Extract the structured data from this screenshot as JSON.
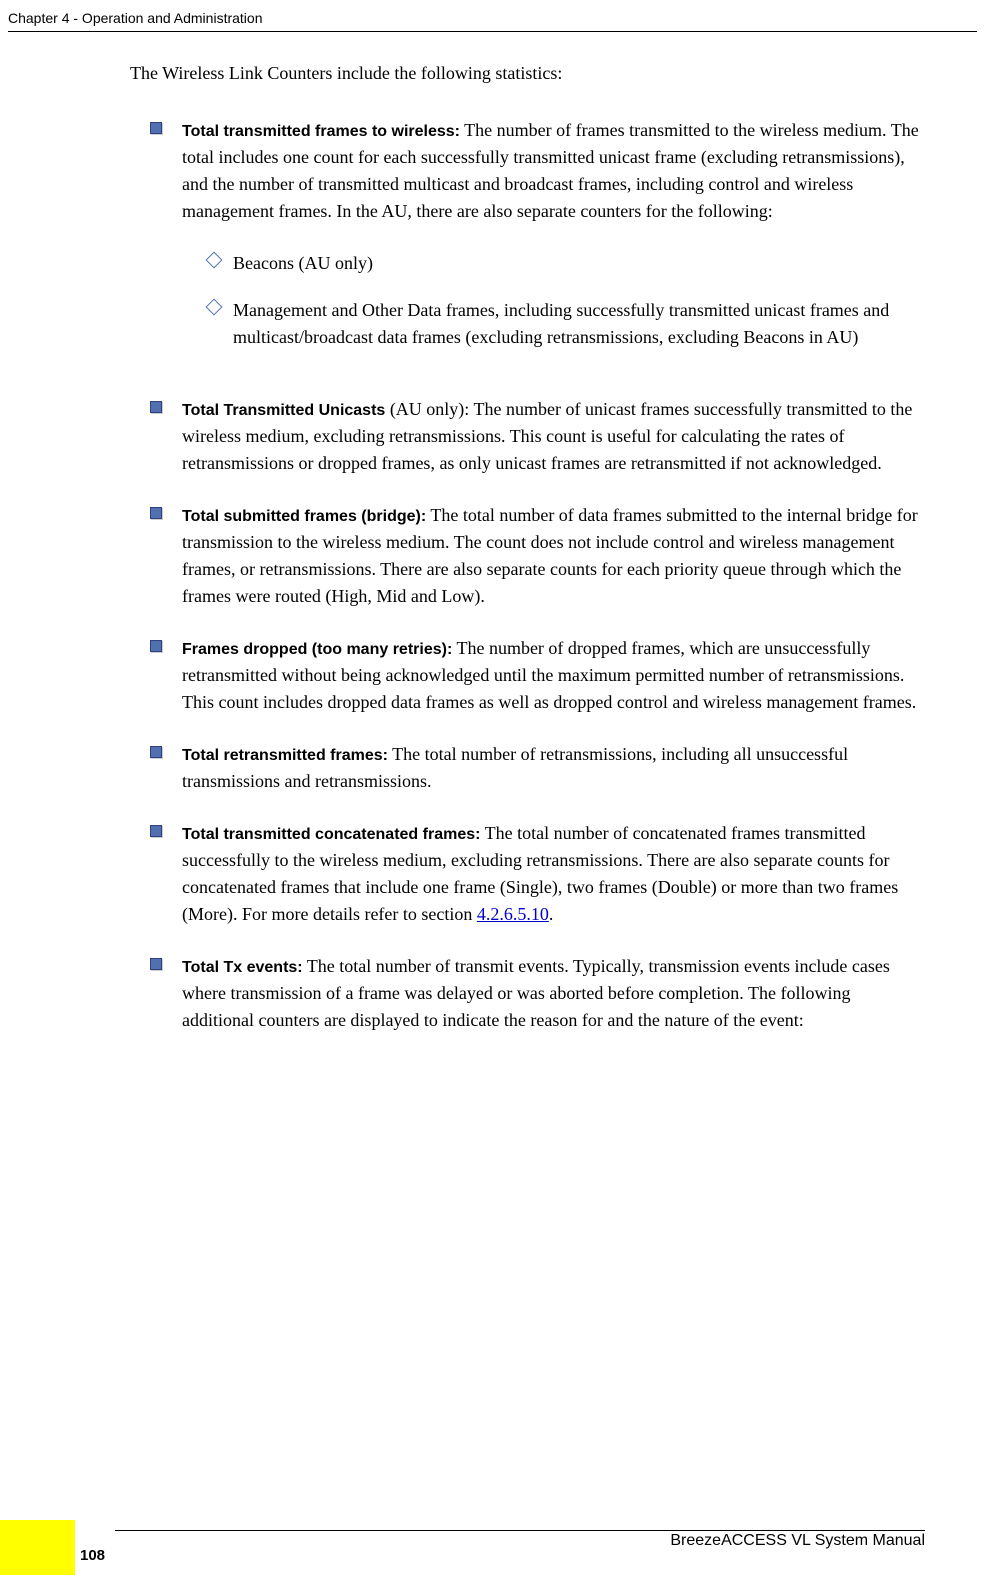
{
  "header": "Chapter 4 - Operation and Administration",
  "intro": "The Wireless Link Counters include the following statistics:",
  "items": [
    {
      "title": "Total transmitted frames to wireless:",
      "body": " The number of frames transmitted to the wireless medium. The total includes one count for each successfully transmitted unicast frame (excluding retransmissions), and the number of transmitted multicast and broadcast frames, including control and wireless management frames. In the AU, there are also separate counters for the following:",
      "sub": [
        "Beacons (AU only)",
        "Management and Other Data frames, including successfully transmitted unicast frames and multicast/broadcast data frames (excluding retransmissions, excluding Beacons in AU)"
      ]
    },
    {
      "title": "Total Transmitted Unicasts",
      "body": " (AU only): The number of unicast frames successfully transmitted to the wireless medium, excluding retransmissions. This count is useful for calculating the rates of retransmissions or dropped frames, as only unicast frames are retransmitted if not acknowledged."
    },
    {
      "title": "Total submitted frames (bridge):",
      "body": " The total number of data frames submitted to the internal bridge for transmission to the wireless medium. The count does not include control and wireless management frames, or retransmissions. There are also separate counts for each priority queue through which the frames were routed (High, Mid and Low)."
    },
    {
      "title": "Frames dropped (too many retries):",
      "body": " The number of dropped frames, which are unsuccessfully retransmitted without being acknowledged until the maximum permitted number of retransmissions. This count includes dropped data frames as well as dropped control and wireless management frames."
    },
    {
      "title": "Total retransmitted frames:",
      "body": " The total number of retransmissions, including all unsuccessful transmissions and retransmissions."
    },
    {
      "title": "Total transmitted concatenated frames:",
      "body": " The total number of concatenated frames transmitted successfully to the wireless medium, excluding retransmissions. There are also separate counts for concatenated frames that include one frame (Single), two frames (Double) or more than two frames (More). For more details refer to section ",
      "link": "4.2.6.5.10",
      "after": "."
    },
    {
      "title": "Total Tx events:",
      "body": " The total number of transmit events. Typically, transmission events include cases where transmission of a frame was delayed or was aborted before completion. The following additional counters are displayed to indicate the reason for and the nature of the event:"
    }
  ],
  "pageNum": "108",
  "footerTitle": "BreezeACCESS VL System Manual"
}
